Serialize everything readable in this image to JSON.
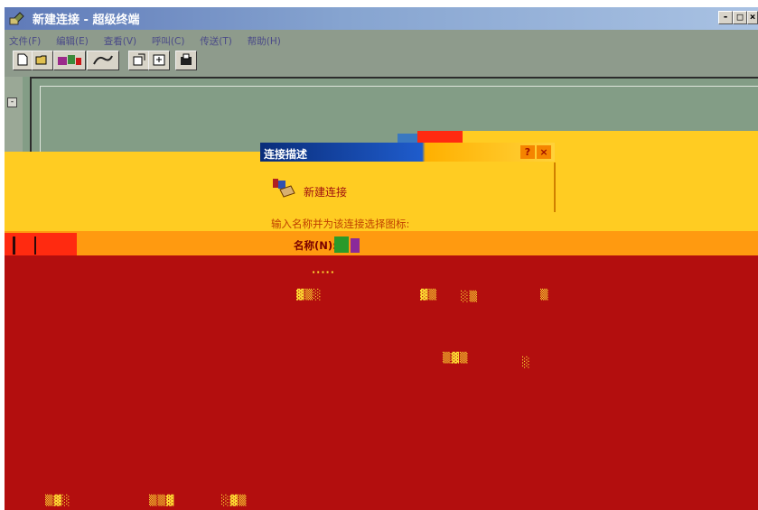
{
  "window": {
    "title": "新建连接 - 超级终端",
    "minimize_label": "-",
    "maximize_label": "□",
    "close_label": "×"
  },
  "menubar": {
    "items": [
      {
        "label": "文件(F)"
      },
      {
        "label": "编辑(E)"
      },
      {
        "label": "查看(V)"
      },
      {
        "label": "呼叫(C)"
      },
      {
        "label": "传送(T)"
      },
      {
        "label": "帮助(H)"
      }
    ]
  },
  "toolbar": {
    "buttons": [
      {
        "icon": "new-document-icon"
      },
      {
        "icon": "open-folder-icon"
      },
      {
        "icon": "phone-icon"
      },
      {
        "icon": "disconnect-icon"
      },
      {
        "icon": "send-icon"
      },
      {
        "icon": "receive-icon"
      },
      {
        "icon": "properties-icon"
      }
    ]
  },
  "terminal": {
    "collapse_label": "-"
  },
  "dialog": {
    "title": "连接描述",
    "help_label": "?",
    "close_label": "×",
    "heading": "新建连接",
    "prompt": "输入名称并为该连接选择图标:",
    "name_label": "名称(N):"
  },
  "colors": {
    "titlebar": "#86a4d0",
    "chrome": "#8e9b8c",
    "terminal_bg": "#839d86",
    "band_yellow": "#ffcc22",
    "band_orange": "#ff9a10",
    "band_red": "#b30e0e"
  }
}
